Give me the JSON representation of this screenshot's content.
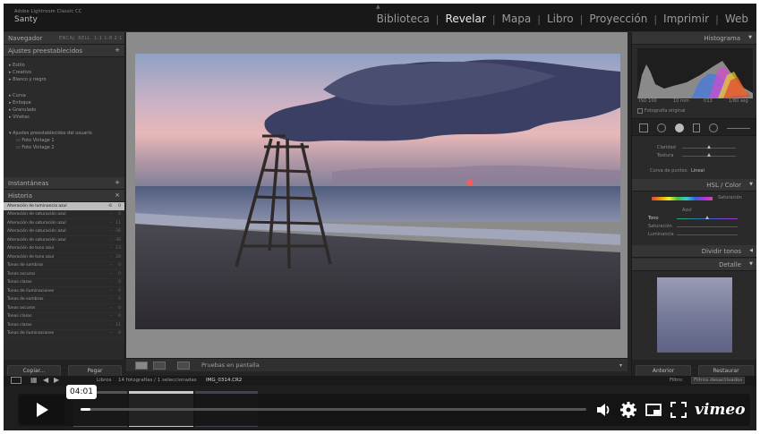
{
  "app": {
    "title": "Adobe Lightroom Classic CC",
    "catalog": "Santy",
    "modules": [
      "Biblioteca",
      "Revelar",
      "Mapa",
      "Libro",
      "Proyección",
      "Imprimir",
      "Web"
    ],
    "active_module": "Revelar"
  },
  "left_panel": {
    "navigator": {
      "label": "Navegador",
      "sub": "ENCAJ.  RELL.  1:1  1:8  2:1"
    },
    "presets": {
      "label": "Ajustes preestablecidos",
      "groups": [
        "Estilo",
        "Creativo",
        "Blanco y negro",
        "Curva",
        "Enfoque",
        "Granulado",
        "Viñetas"
      ],
      "user_group": "Ajustes preestablecidos del usuario",
      "user_items": [
        "Foto Vintage 1",
        "Foto Vintage 2"
      ]
    },
    "snapshots_label": "Instantáneas",
    "history": {
      "label": "Historia",
      "rows": [
        {
          "name": "Alteración de luminancia azul",
          "a": "-6",
          "b": "0"
        },
        {
          "name": "Alteración de saturación azul",
          "a": "-",
          "b": "0"
        },
        {
          "name": "Alteración de saturación azul",
          "a": "-",
          "b": "11"
        },
        {
          "name": "Alteración de saturación azul",
          "a": "-",
          "b": "-36"
        },
        {
          "name": "Alteración de saturación azul",
          "a": "-",
          "b": "-36"
        },
        {
          "name": "Alteración de tono azul",
          "a": "-",
          "b": "13"
        },
        {
          "name": "Alteración de tono azul",
          "a": "-",
          "b": "20"
        },
        {
          "name": "Tonos de sombras",
          "a": "-",
          "b": "0"
        },
        {
          "name": "Tonos oscuros",
          "a": "-",
          "b": "0"
        },
        {
          "name": "Tonos claros",
          "a": "-",
          "b": "0"
        },
        {
          "name": "Tonos de iluminaciones",
          "a": "-",
          "b": "0"
        },
        {
          "name": "Tonos de sombras",
          "a": "-",
          "b": "0"
        },
        {
          "name": "Tonos oscuros",
          "a": "-",
          "b": "0"
        },
        {
          "name": "Tonos claros",
          "a": "-",
          "b": "0"
        },
        {
          "name": "Tonos claros",
          "a": "-",
          "b": "11"
        },
        {
          "name": "Tonos de iluminaciones",
          "a": "-",
          "b": "0"
        }
      ]
    },
    "copy_label": "Copiar...",
    "paste_label": "Pegar"
  },
  "toolbar": {
    "proof_label": "Pruebas en pantalla"
  },
  "right_panel": {
    "histogram_label": "Histograma",
    "histogram_values": [
      "ISO 100",
      "10 mm",
      "f/13",
      "1/80 seg"
    ],
    "original_photo_label": "Fotografía original",
    "sliders": [
      "Claridad",
      "Textura"
    ],
    "profile_label": "Curva de puntos:",
    "profile_value": "Lineal",
    "hsl": {
      "label": "HSL / Color",
      "sat": "Saturación",
      "rows": [
        "Tono",
        "Saturación",
        "Luminancia"
      ],
      "header": "Azul"
    },
    "divide_tones_label": "Dividir tonos",
    "detail_label": "Detalle",
    "previous_label": "Anterior",
    "reset_label": "Restaurar"
  },
  "filmstrip": {
    "count": "14 fotografías / 1 seleccionadas",
    "file": "IMG_0314.CR2",
    "filter_label": "Filtro:",
    "filter_value": "Filtros desactivados",
    "source": "Libros"
  },
  "player": {
    "time": "04:01",
    "progress": 0.02,
    "brand": "vimeo"
  }
}
